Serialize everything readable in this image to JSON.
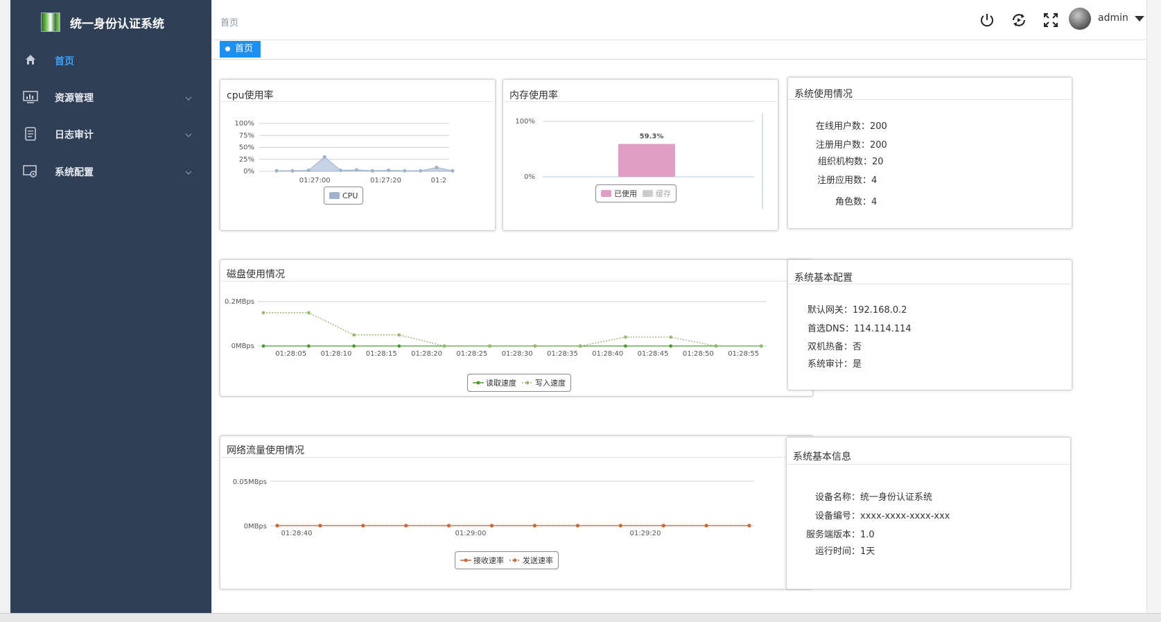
{
  "app": {
    "title": "统一身份认证系统",
    "user": "admin"
  },
  "sidebar": {
    "items": [
      {
        "label": "首页",
        "icon": "home-icon",
        "active": true
      },
      {
        "label": "资源管理",
        "icon": "monitor-chart-icon",
        "active": false
      },
      {
        "label": "日志审计",
        "icon": "document-list-icon",
        "active": false
      },
      {
        "label": "系统配置",
        "icon": "settings-screen-icon",
        "active": false
      }
    ]
  },
  "header": {
    "breadcrumb": "首页",
    "tools": [
      "power-icon",
      "refresh-icon",
      "fullscreen-icon"
    ]
  },
  "tabs": [
    {
      "label": "首页",
      "active": true
    }
  ],
  "panels": {
    "cpu": {
      "title": "cpu使用率"
    },
    "memory": {
      "title": "内存使用率"
    },
    "disk": {
      "title": "磁盘使用情况"
    },
    "network": {
      "title": "网络流量使用情况"
    },
    "system_usage": {
      "title": "系统使用情况",
      "rows": [
        {
          "label": "在线用户数：",
          "value": "200"
        },
        {
          "label": "注册用户数：",
          "value": "200"
        },
        {
          "label": "组织机构数：",
          "value": "20"
        },
        {
          "label": "注册应用数：",
          "value": "4"
        },
        {
          "label": "角色数：",
          "value": "4"
        }
      ]
    },
    "system_config": {
      "title": "系统基本配置",
      "rows": [
        {
          "label": "默认网关：",
          "value": "192.168.0.2"
        },
        {
          "label": "首选DNS：",
          "value": "114.114.114"
        },
        {
          "label": "双机热备：",
          "value": "否"
        },
        {
          "label": "系统审计：",
          "value": "是"
        }
      ]
    },
    "system_info": {
      "title": "系统基本信息",
      "rows": [
        {
          "label": "设备名称：",
          "value": "统一身份认证系统"
        },
        {
          "label": "设备编号：",
          "value": "xxxx-xxxx-xxxx-xxx"
        },
        {
          "label": "服务端版本：",
          "value": "1.0"
        },
        {
          "label": "运行时间：",
          "value": "1天"
        }
      ]
    }
  },
  "colors": {
    "sidebar_bg": "#2f3f55",
    "accent": "#1f8ff0",
    "cpu_series": "#9fb3d1",
    "memory_used": "#e09ec4",
    "memory_cache": "#cccccc",
    "disk_read": "#4a9a2e",
    "disk_write": "#9ab870",
    "net_series": "#c8693a"
  },
  "chart_data": [
    {
      "id": "cpu",
      "type": "area",
      "yticks": [
        "100%",
        "75%",
        "50%",
        "25%",
        "0%"
      ],
      "ylim": [
        0,
        100
      ],
      "xticks": [
        "01:27:00",
        "01:27:20",
        "01:2"
      ],
      "series": [
        {
          "name": "CPU",
          "values": [
            1,
            1,
            2,
            30,
            2,
            3,
            1,
            2,
            1,
            1,
            8,
            1
          ]
        }
      ],
      "legend": [
        "CPU"
      ]
    },
    {
      "id": "memory",
      "type": "bar",
      "yticks": [
        "100%",
        "0%"
      ],
      "ylim": [
        0,
        100
      ],
      "data_label": "59.3%",
      "series": [
        {
          "name": "已使用",
          "values": [
            59.3
          ]
        },
        {
          "name": "缓存",
          "values": [
            0
          ]
        }
      ],
      "legend": [
        "已使用",
        "缓存"
      ]
    },
    {
      "id": "disk",
      "type": "line",
      "yticks": [
        "0.2MBps",
        "0MBps"
      ],
      "ylim": [
        0,
        0.2
      ],
      "x": [
        "01:28:05",
        "01:28:10",
        "01:28:15",
        "01:28:20",
        "01:28:25",
        "01:28:30",
        "01:28:35",
        "01:28:40",
        "01:28:45",
        "01:28:50",
        "01:28:55"
      ],
      "series": [
        {
          "name": "读取速度",
          "values": [
            0,
            0,
            0,
            0,
            0,
            0,
            0,
            0,
            0,
            0,
            0,
            0
          ]
        },
        {
          "name": "写入速度",
          "values": [
            0.15,
            0.15,
            0.05,
            0.05,
            0,
            0,
            0,
            0,
            0.04,
            0.04,
            0,
            0
          ]
        }
      ],
      "legend": [
        "读取速度",
        "写入速度"
      ]
    },
    {
      "id": "network",
      "type": "line",
      "yticks": [
        "0.05MBps",
        "0MBps"
      ],
      "ylim": [
        0,
        0.05
      ],
      "x": [
        "01:28:40",
        "01:29:00",
        "01:29:20"
      ],
      "series": [
        {
          "name": "接收速率",
          "values": [
            0,
            0,
            0,
            0,
            0,
            0,
            0,
            0,
            0,
            0,
            0,
            0
          ]
        },
        {
          "name": "发送速率",
          "values": [
            0,
            0,
            0,
            0,
            0,
            0,
            0,
            0,
            0,
            0,
            0,
            0
          ]
        }
      ],
      "legend": [
        "接收速率",
        "发送速率"
      ]
    }
  ]
}
